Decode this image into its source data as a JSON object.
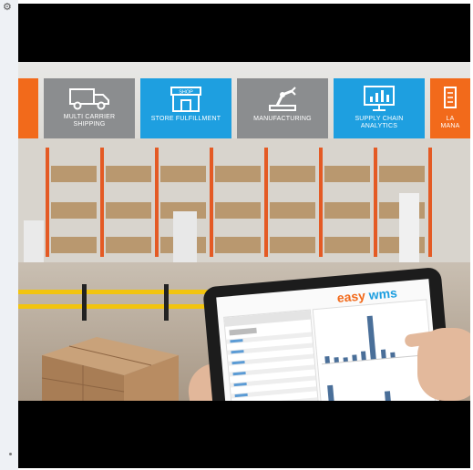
{
  "tiles": [
    {
      "label": "",
      "color": "#f26a1b",
      "icon": "partial-tile"
    },
    {
      "label": "MULTI CARRIER SHIPPING",
      "color": "#8b8d8f",
      "icon": "truck-icon"
    },
    {
      "label": "STORE FULFILLMENT",
      "color": "#1e9fe0",
      "icon": "shop-icon"
    },
    {
      "label": "MANUFACTURING",
      "color": "#8b8d8f",
      "icon": "robot-arm-icon"
    },
    {
      "label": "SUPPLY CHAIN ANALYTICS",
      "color": "#1e9fe0",
      "icon": "monitor-chart-icon"
    },
    {
      "label": "LA MANA",
      "color": "#f26a1b",
      "icon": "partial-tile"
    }
  ],
  "shop_sign": "SHOP",
  "tablet": {
    "brand_prefix": "easy",
    "brand_mark": "wms"
  },
  "colors": {
    "blue": "#1e9fe0",
    "gray": "#8b8d8f",
    "orange": "#f26a1b"
  }
}
